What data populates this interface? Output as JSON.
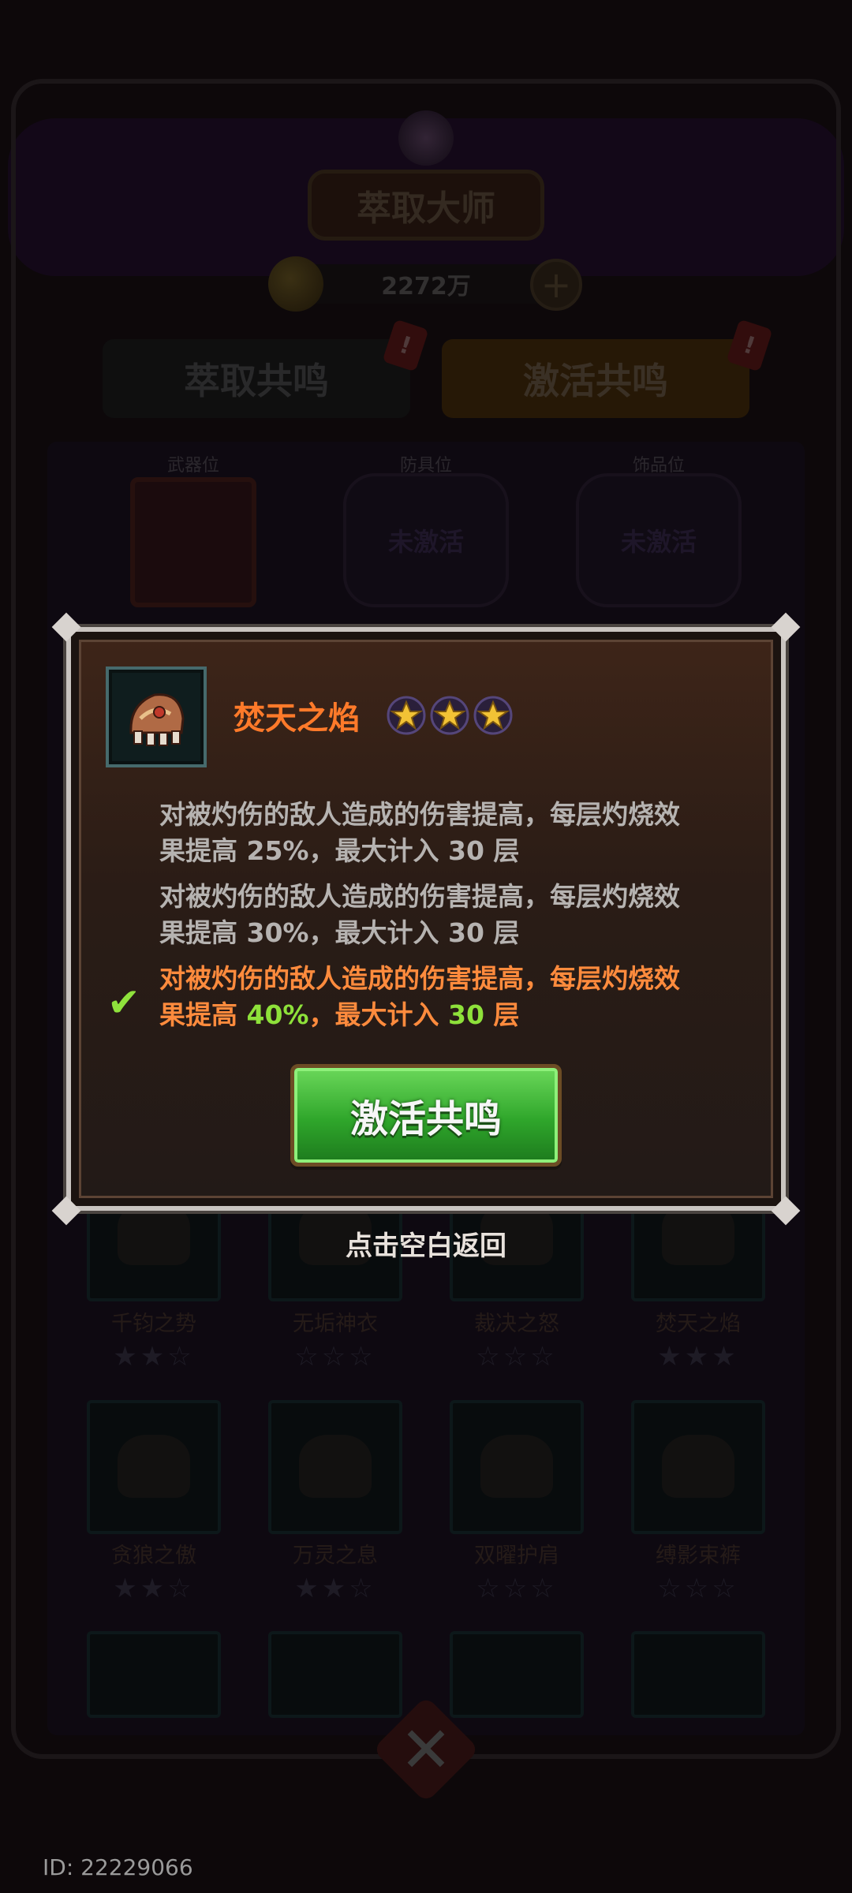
{
  "header": {
    "title": "萃取大师",
    "currency": "2272万"
  },
  "tabs": [
    {
      "label": "萃取共鸣",
      "badge": "!"
    },
    {
      "label": "激活共鸣",
      "badge": "!"
    }
  ],
  "slots": [
    {
      "label": "武器位",
      "status": ""
    },
    {
      "label": "防具位",
      "status": "未激活"
    },
    {
      "label": "饰品位",
      "status": "未激活"
    }
  ],
  "grid": [
    {
      "name": "千钧之势",
      "stars": "★★☆"
    },
    {
      "name": "无垢神衣",
      "stars": "☆☆☆"
    },
    {
      "name": "裁决之怒",
      "stars": "☆☆☆"
    },
    {
      "name": "焚天之焰",
      "stars": "★★★"
    },
    {
      "name": "贪狼之傲",
      "stars": "★★☆"
    },
    {
      "name": "万灵之息",
      "stars": "★★☆"
    },
    {
      "name": "双曜护肩",
      "stars": "☆☆☆"
    },
    {
      "name": "缚影束裤",
      "stars": "☆☆☆"
    }
  ],
  "modal": {
    "item_name": "焚天之焰",
    "stars": 3,
    "tiers": [
      {
        "line1": "对被灼伤的敌人造成的伤害提高，每层灼烧效",
        "pre": "果提高 ",
        "value": "25%",
        "mid": "，最大计入 ",
        "layers": "30",
        "post": " 层",
        "active": false
      },
      {
        "line1": "对被灼伤的敌人造成的伤害提高，每层灼烧效",
        "pre": "果提高 ",
        "value": "30%",
        "mid": "，最大计入 ",
        "layers": "30",
        "post": " 层",
        "active": false
      },
      {
        "line1": "对被灼伤的敌人造成的伤害提高，每层灼烧效",
        "pre": "果提高 ",
        "value": "40%",
        "mid": "，最大计入 ",
        "layers": "30",
        "post": " 层",
        "active": true
      }
    ],
    "check_icon": "✔",
    "activate_label": "激活共鸣"
  },
  "return_hint": "点击空白返回",
  "player_id": "ID: 22229066",
  "colors": {
    "item_name": "#ff7a2a",
    "active_text": "#ff8b3d",
    "active_value": "#8ee13a",
    "button_green": "#2fa62b"
  }
}
